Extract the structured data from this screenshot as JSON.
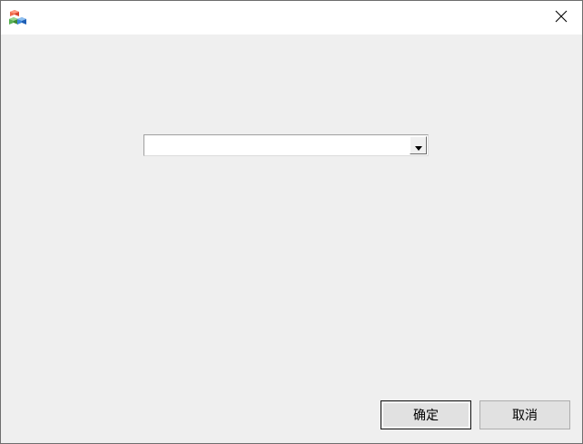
{
  "window": {
    "title": "",
    "app_icon": "app-blocks-icon",
    "close_icon": "close-icon"
  },
  "combo": {
    "selected_value": ""
  },
  "buttons": {
    "ok_label": "确定",
    "cancel_label": "取消"
  },
  "colors": {
    "dialog_background": "#efefef",
    "titlebar_background": "#ffffff"
  }
}
